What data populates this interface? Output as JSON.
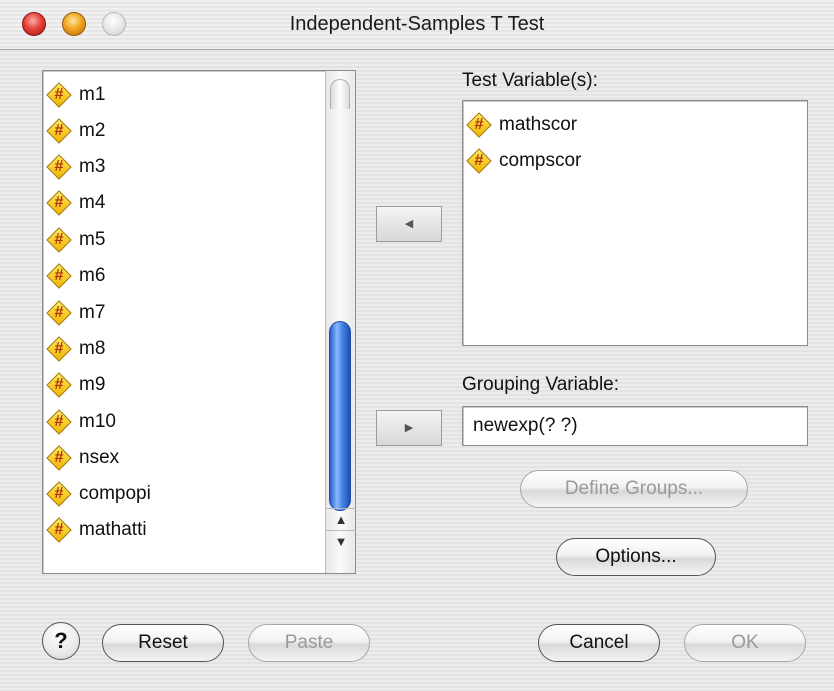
{
  "window": {
    "title": "Independent-Samples T Test"
  },
  "source_list": {
    "items": [
      {
        "label": "m1"
      },
      {
        "label": "m2"
      },
      {
        "label": "m3"
      },
      {
        "label": "m4"
      },
      {
        "label": "m5"
      },
      {
        "label": "m6"
      },
      {
        "label": "m7"
      },
      {
        "label": "m8"
      },
      {
        "label": "m9"
      },
      {
        "label": "m10"
      },
      {
        "label": "nsex"
      },
      {
        "label": "compopi"
      },
      {
        "label": "mathatti"
      }
    ]
  },
  "test_variables": {
    "label": "Test Variable(s):",
    "items": [
      {
        "label": "mathscor"
      },
      {
        "label": "compscor"
      }
    ]
  },
  "grouping": {
    "label": "Grouping Variable:",
    "value": "newexp(? ?)"
  },
  "buttons": {
    "move_left": "◀",
    "move_right": "▶",
    "define_groups": "Define Groups...",
    "options": "Options...",
    "help": "?",
    "reset": "Reset",
    "paste": "Paste",
    "cancel": "Cancel",
    "ok": "OK"
  },
  "scroll": {
    "up": "▲",
    "down": "▼"
  },
  "icons": {
    "variable": "scale-variable-icon",
    "hash_glyph": "#"
  }
}
